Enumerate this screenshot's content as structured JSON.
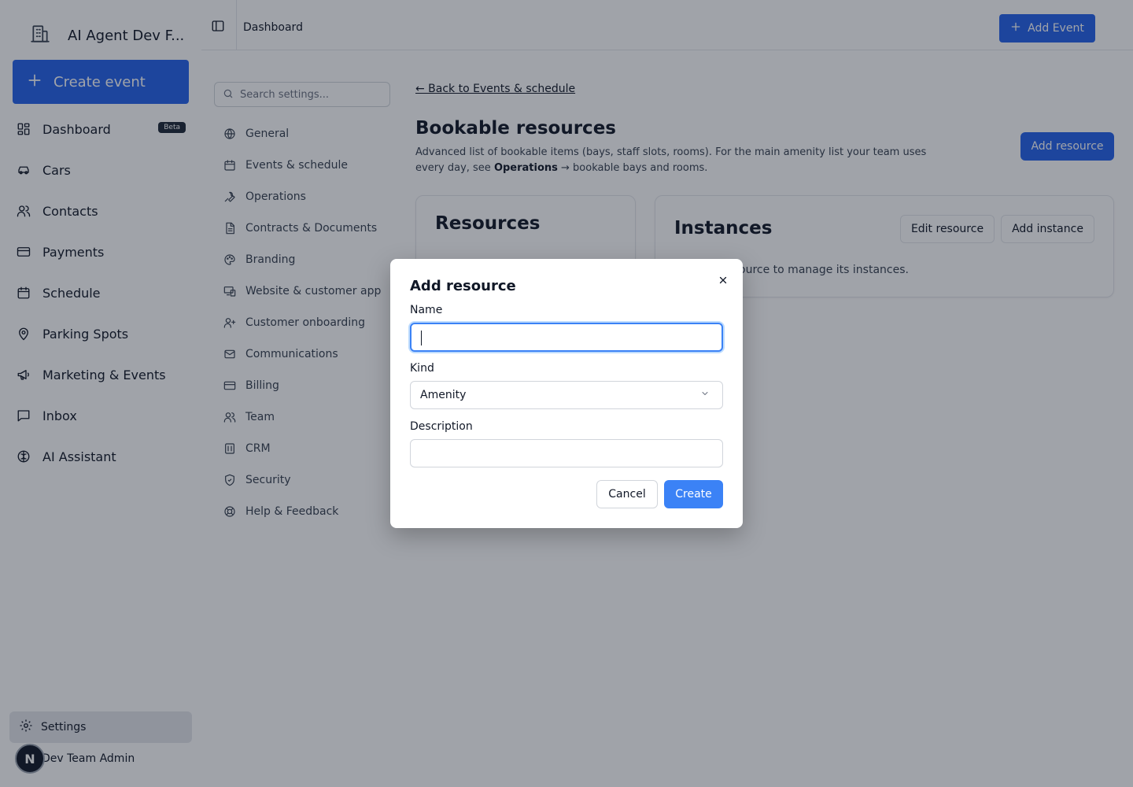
{
  "app": {
    "name": "AI Agent Dev F..."
  },
  "sidebar": {
    "create_label": "Create event",
    "items": [
      {
        "label": "Dashboard",
        "icon": "dashboard-icon",
        "badge": "Beta"
      },
      {
        "label": "Cars",
        "icon": "car-icon"
      },
      {
        "label": "Contacts",
        "icon": "users-icon"
      },
      {
        "label": "Payments",
        "icon": "credit-card-icon"
      },
      {
        "label": "Schedule",
        "icon": "calendar-icon"
      },
      {
        "label": "Parking Spots",
        "icon": "map-pin-icon"
      },
      {
        "label": "Marketing & Events",
        "icon": "megaphone-icon"
      },
      {
        "label": "Inbox",
        "icon": "message-square-icon"
      },
      {
        "label": "AI Assistant",
        "icon": "brain-icon"
      }
    ],
    "settings_label": "Settings",
    "user": {
      "initial": "N",
      "name": "Dev Team Admin"
    }
  },
  "topbar": {
    "breadcrumb": "Dashboard",
    "add_event_label": "Add Event"
  },
  "settings_nav": {
    "search_placeholder": "Search settings...",
    "items": [
      {
        "label": "General",
        "icon": "globe-icon"
      },
      {
        "label": "Events & schedule",
        "icon": "calendar-icon"
      },
      {
        "label": "Operations",
        "icon": "wrench-icon"
      },
      {
        "label": "Contracts & Documents",
        "icon": "file-icon"
      },
      {
        "label": "Branding",
        "icon": "palette-icon"
      },
      {
        "label": "Website & customer app",
        "icon": "devices-icon"
      },
      {
        "label": "Customer onboarding",
        "icon": "user-plus-icon"
      },
      {
        "label": "Communications",
        "icon": "mail-icon"
      },
      {
        "label": "Billing",
        "icon": "credit-card-icon"
      },
      {
        "label": "Team",
        "icon": "users-icon"
      },
      {
        "label": "CRM",
        "icon": "crm-icon"
      },
      {
        "label": "Security",
        "icon": "shield-icon"
      },
      {
        "label": "Help & Feedback",
        "icon": "life-buoy-icon"
      }
    ]
  },
  "page": {
    "back_link": "← Back to Events & schedule",
    "title": "Bookable resources",
    "description_pre": "Advanced list of bookable items (bays, staff slots, rooms). For the main amenity list your team uses every day, see ",
    "description_bold": "Operations",
    "description_post": " → bookable bays and rooms.",
    "add_resource_label": "Add resource",
    "resources_card": {
      "title": "Resources"
    },
    "instances_card": {
      "title": "Instances",
      "edit_label": "Edit resource",
      "add_instance_label": "Add instance",
      "empty_text": "Select a resource to manage its instances."
    }
  },
  "dialog": {
    "title": "Add resource",
    "name_label": "Name",
    "name_value": "",
    "kind_label": "Kind",
    "kind_value": "Amenity",
    "description_label": "Description",
    "description_value": "",
    "cancel_label": "Cancel",
    "create_label": "Create"
  },
  "colors": {
    "primary": "#2563eb",
    "dialog_primary": "#3b82f6",
    "overlay": "rgba(17,24,39,0.40)"
  }
}
